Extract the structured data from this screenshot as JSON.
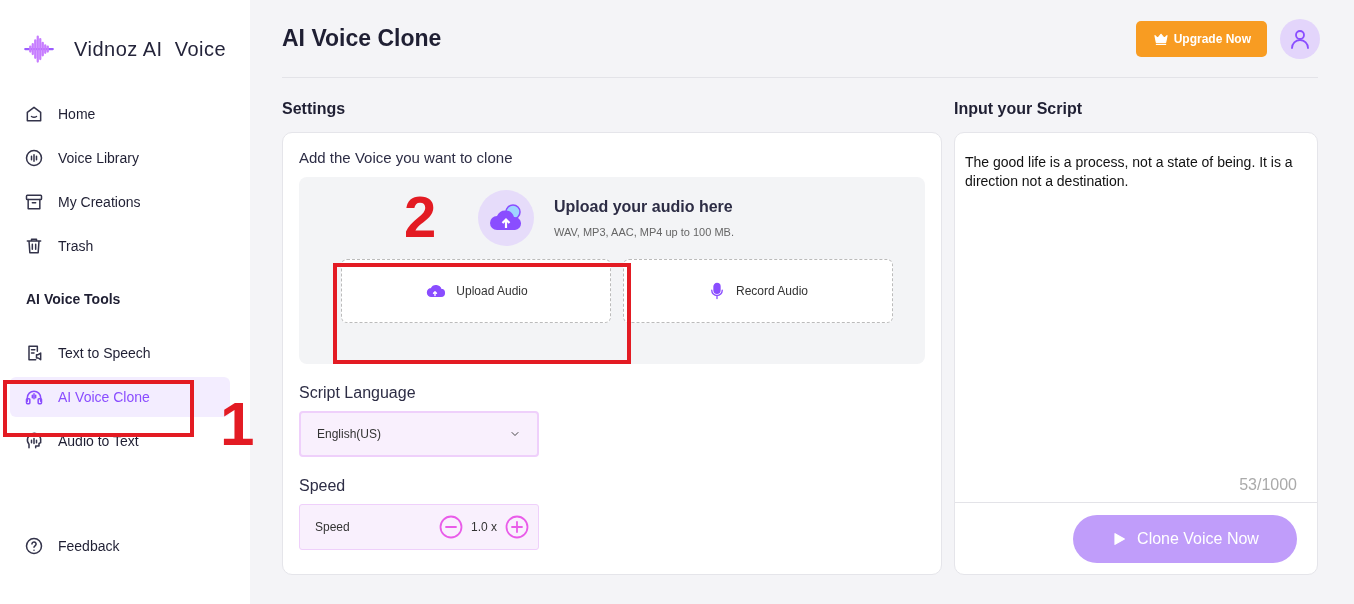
{
  "logo": {
    "brand": "Vidnoz AI",
    "product": "Voice"
  },
  "sidebar": {
    "items": [
      {
        "label": "Home",
        "selected": false
      },
      {
        "label": "Voice Library",
        "selected": false
      },
      {
        "label": "My Creations",
        "selected": false
      },
      {
        "label": "Trash",
        "selected": false
      }
    ],
    "section_title": "AI Voice Tools",
    "tools": [
      {
        "label": "Text to Speech",
        "selected": false
      },
      {
        "label": "AI Voice Clone",
        "selected": true
      },
      {
        "label": "Audio to Text",
        "selected": false
      }
    ],
    "footer_item": {
      "label": "Feedback"
    }
  },
  "header": {
    "title": "AI Voice Clone",
    "upgrade_button": "Upgrade Now"
  },
  "settings": {
    "title": "Settings",
    "card_title": "Add the Voice you want to clone",
    "upload": {
      "heading": "Upload your audio here",
      "hint": "WAV, MP3, AAC, MP4 up to 100 MB.",
      "buttons": [
        {
          "kind": "upload",
          "label": "Upload Audio"
        },
        {
          "kind": "record",
          "label": "Record Audio"
        }
      ]
    },
    "language": {
      "label": "Script Language",
      "value": "English(US)"
    },
    "speed": {
      "label": "Speed",
      "field_label": "Speed",
      "value": "1.0 x"
    }
  },
  "script": {
    "title": "Input your Script",
    "text": "The good life is a process, not a state of being. It is a direction not a destination.",
    "counter": "53/1000",
    "button": "Clone Voice Now"
  },
  "annotations": [
    {
      "label": "1"
    },
    {
      "label": "2"
    }
  ]
}
